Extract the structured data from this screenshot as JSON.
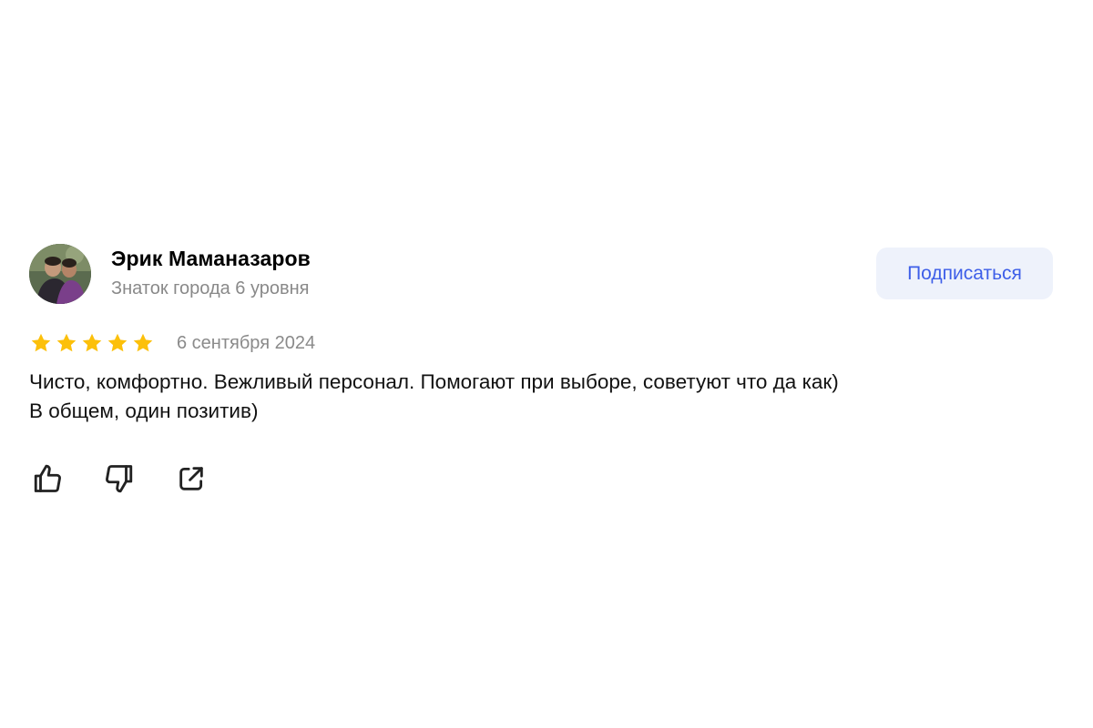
{
  "author": {
    "name": "Эрик Маманазаров",
    "level": "Знаток города 6 уровня"
  },
  "subscribe_label": "Подписаться",
  "rating": {
    "value": 5,
    "max": 5,
    "star_color": "#fcc00a"
  },
  "date": "6 сентября 2024",
  "review_text": [
    "Чисто, комфортно. Вежливый персонал. Помогают при выборе, советуют что да как)",
    "В общем, один позитив)"
  ],
  "colors": {
    "accent": "#3d5ee8",
    "button_bg": "#eef2fb",
    "secondary_text": "#898989"
  },
  "actions": [
    {
      "icon": "thumbs-up-icon"
    },
    {
      "icon": "thumbs-down-icon"
    },
    {
      "icon": "share-icon"
    }
  ]
}
